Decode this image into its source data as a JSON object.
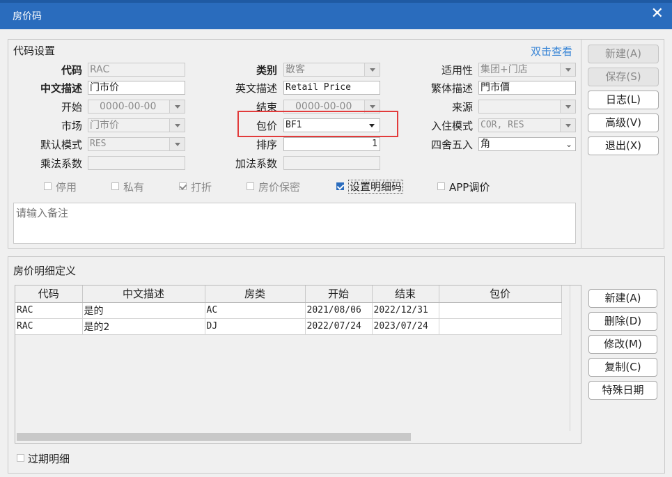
{
  "window": {
    "title": "房价码",
    "close_glyph": "✕"
  },
  "settings": {
    "group_title": "代码设置",
    "double_click_link": "双击查看",
    "code_label": "代码",
    "code_value": "RAC",
    "category_label": "类别",
    "category_value": "散客",
    "applicability_label": "适用性",
    "applicability_value": "集团+门店",
    "cn_desc_label": "中文描述",
    "cn_desc_value": "门市价",
    "en_desc_label": "英文描述",
    "en_desc_value": "Retail Price",
    "tc_desc_label": "繁体描述",
    "tc_desc_value": "門市價",
    "start_label": "开始",
    "start_value": "0000-00-00",
    "end_label": "结束",
    "end_value": "0000-00-00",
    "source_label": "来源",
    "source_value": "",
    "market_label": "市场",
    "market_value": "门市价",
    "package_label": "包价",
    "package_value": "BF1",
    "checkin_mode_label": "入住模式",
    "checkin_mode_value": "COR, RES",
    "default_mode_label": "默认模式",
    "default_mode_value": "RES",
    "sort_label": "排序",
    "sort_value": "1",
    "rounding_label": "四舍五入",
    "rounding_value": "角",
    "mult_factor_label": "乘法系数",
    "mult_factor_value": "",
    "add_factor_label": "加法系数",
    "add_factor_value": "",
    "checkboxes": [
      {
        "label": "停用",
        "checked": false,
        "enabled": false
      },
      {
        "label": "私有",
        "checked": false,
        "enabled": false
      },
      {
        "label": "打折",
        "checked": true,
        "enabled": false
      },
      {
        "label": "房价保密",
        "checked": false,
        "enabled": false
      },
      {
        "label": "设置明细码",
        "checked": true,
        "enabled": true
      },
      {
        "label": "APP调价",
        "checked": false,
        "enabled": true
      }
    ],
    "remark_placeholder": "请输入备注",
    "highlight_color": "#e23b3b"
  },
  "top_buttons": {
    "new": "新建(A)",
    "save": "保存(S)",
    "log": "日志(L)",
    "advanced": "高级(V)",
    "exit": "退出(X)"
  },
  "details": {
    "group_title": "房价明细定义",
    "columns": [
      "代码",
      "中文描述",
      "房类",
      "开始",
      "结束",
      "包价"
    ],
    "rows": [
      [
        "RAC",
        "是的",
        "AC",
        "2021/08/06",
        "2022/12/31",
        ""
      ],
      [
        "RAC",
        "是的2",
        "DJ",
        "2022/07/24",
        "2023/07/24",
        ""
      ]
    ],
    "expired_label": "过期明细"
  },
  "detail_buttons": {
    "new": "新建(A)",
    "delete": "删除(D)",
    "edit": "修改(M)",
    "copy": "复制(C)",
    "special_dates": "特殊日期"
  },
  "colors": {
    "titlebar": "#2a6cbd",
    "link": "#3a86d6"
  }
}
